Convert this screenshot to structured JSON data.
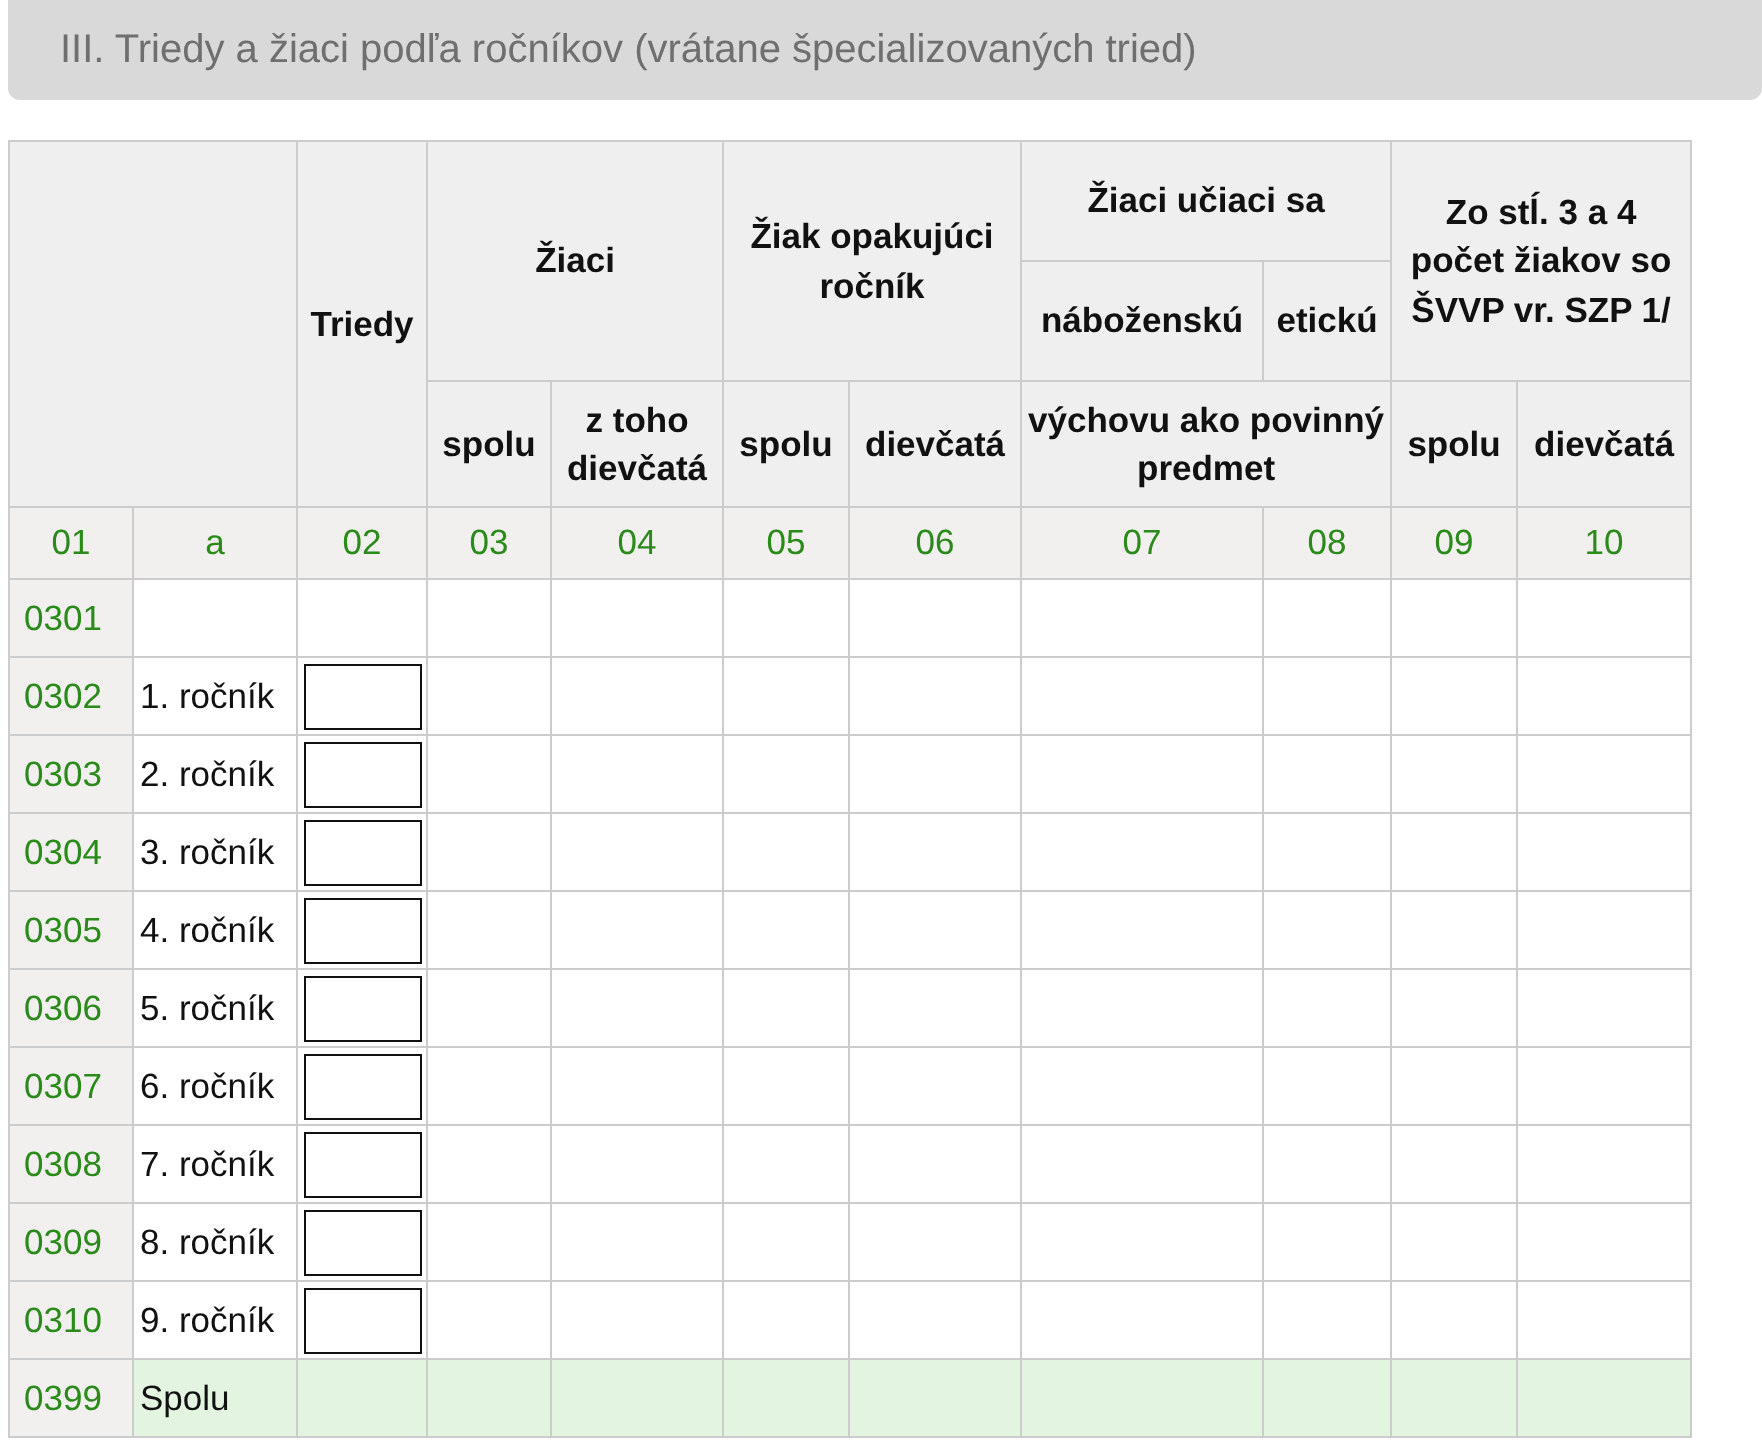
{
  "section_title": "III. Triedy a žiaci podľa ročníkov (vrátane špecializovaných tried)",
  "header": {
    "classes": "Triedy",
    "pupils": {
      "title": "Žiaci",
      "sub": [
        "spolu",
        "z toho dievčatá"
      ]
    },
    "repeating": {
      "title": "Žiak opakujúci ročník",
      "sub": [
        "spolu",
        "dievčatá"
      ]
    },
    "religion": {
      "title": "Žiaci učiaci sa",
      "sub": [
        "náboženskú",
        "etickú"
      ],
      "note": "výchovu ako povinný predmet"
    },
    "svvp": {
      "title": "Zo stĺ. 3 a 4 počet žiakov so ŠVVP vr. SZP 1/",
      "sub": [
        "spolu",
        "dievčatá"
      ]
    }
  },
  "column_codes": [
    "01",
    "a",
    "02",
    "03",
    "04",
    "05",
    "06",
    "07",
    "08",
    "09",
    "10"
  ],
  "rows": [
    {
      "code": "0301",
      "kind": "blank"
    },
    {
      "code": "0302",
      "label": "1. ročník",
      "kind": "input"
    },
    {
      "code": "0303",
      "label": "2. ročník",
      "kind": "input"
    },
    {
      "code": "0304",
      "label": "3. ročník",
      "kind": "input"
    },
    {
      "code": "0305",
      "label": "4. ročník",
      "kind": "input"
    },
    {
      "code": "0306",
      "label": "5. ročník",
      "kind": "input"
    },
    {
      "code": "0307",
      "label": "6. ročník",
      "kind": "input"
    },
    {
      "code": "0308",
      "label": "7. ročník",
      "kind": "input"
    },
    {
      "code": "0309",
      "label": "8. ročník",
      "kind": "input"
    },
    {
      "code": "0310",
      "label": "9. ročník",
      "kind": "input"
    },
    {
      "code": "0399",
      "label": "Spolu",
      "kind": "total"
    }
  ]
}
